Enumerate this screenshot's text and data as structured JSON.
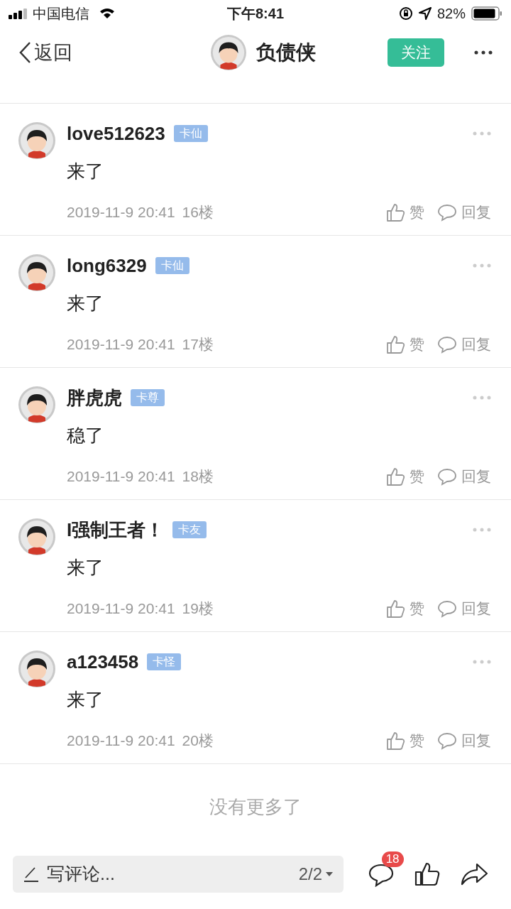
{
  "status_bar": {
    "carrier": "中国电信",
    "time": "下午8:41",
    "battery": "82%"
  },
  "nav": {
    "back": "返回",
    "title": "负债侠",
    "follow": "关注"
  },
  "posts": [
    {
      "user": "love512623",
      "badge": "卡仙",
      "text": "来了",
      "time": "2019-11-9 20:41",
      "floor": "16楼",
      "like": "赞",
      "reply": "回复"
    },
    {
      "user": "long6329",
      "badge": "卡仙",
      "text": "来了",
      "time": "2019-11-9 20:41",
      "floor": "17楼",
      "like": "赞",
      "reply": "回复"
    },
    {
      "user": "胖虎虎",
      "badge": "卡尊",
      "text": "稳了",
      "time": "2019-11-9 20:41",
      "floor": "18楼",
      "like": "赞",
      "reply": "回复"
    },
    {
      "user": "I强制王者！",
      "badge": "卡友",
      "text": "来了",
      "time": "2019-11-9 20:41",
      "floor": "19楼",
      "like": "赞",
      "reply": "回复"
    },
    {
      "user": "a123458",
      "badge": "卡怪",
      "text": "来了",
      "time": "2019-11-9 20:41",
      "floor": "20楼",
      "like": "赞",
      "reply": "回复"
    }
  ],
  "end_text": "没有更多了",
  "bottom_bar": {
    "placeholder": "写评论...",
    "page": "2/2",
    "comment_count": "18"
  }
}
